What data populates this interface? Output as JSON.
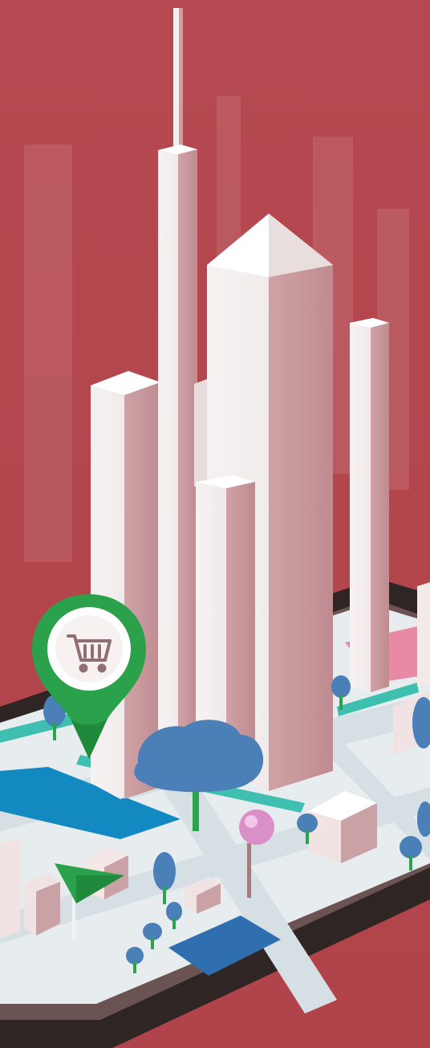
{
  "scene": {
    "background_color": "#b5474d",
    "building_face_light": "#f4eeee",
    "building_face_shade": "#c9979b",
    "map_ground": "#e9eef0",
    "road_color": "#dfe6ea",
    "water_color": "#1289c0",
    "pin_shopping_color": "#2aa14a",
    "pin_location_color": "#d990c8",
    "tree_color": "#4a7fb7",
    "flag_color": "#2aa14a",
    "device_frame_color": "#3a2e2c"
  },
  "icons": {
    "shopping_pin": "shopping-cart-icon",
    "location_pin": "map-pin-icon",
    "flag": "flag-icon"
  }
}
